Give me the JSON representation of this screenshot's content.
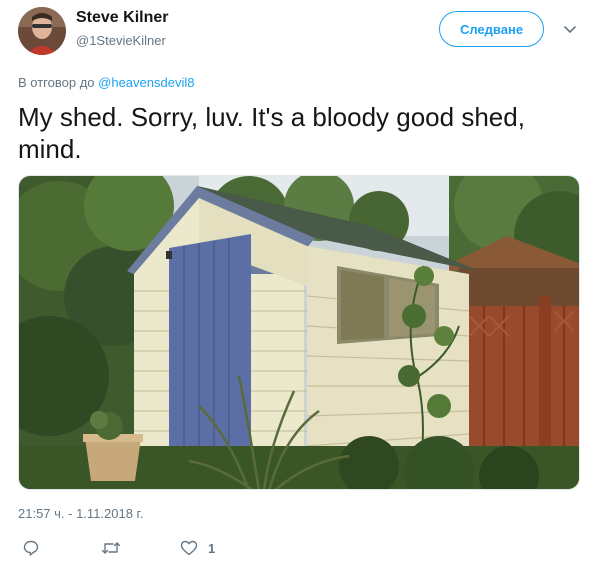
{
  "user": {
    "name": "Steve Kilner",
    "handle": "@1StevieKilner",
    "avatar_icon": "avatar-photo"
  },
  "follow_button": {
    "label": "Следване"
  },
  "menu_icon": "chevron-down-icon",
  "reply": {
    "prefix": "В отговор до",
    "mention": "@heavensdevil8"
  },
  "tweet": {
    "text": "My shed. Sorry, luv. It's a bloody good shed, mind."
  },
  "media": {
    "description_icon": "shed-photo"
  },
  "meta": {
    "timestamp": "21:57 ч. - 1.11.2018 г."
  },
  "actions": {
    "reply_icon": "reply-icon",
    "retweet_icon": "retweet-icon",
    "like_icon": "heart-icon",
    "like_count": "1"
  },
  "colors": {
    "accent": "#1da1f2",
    "text": "#14171a",
    "muted": "#657786"
  }
}
